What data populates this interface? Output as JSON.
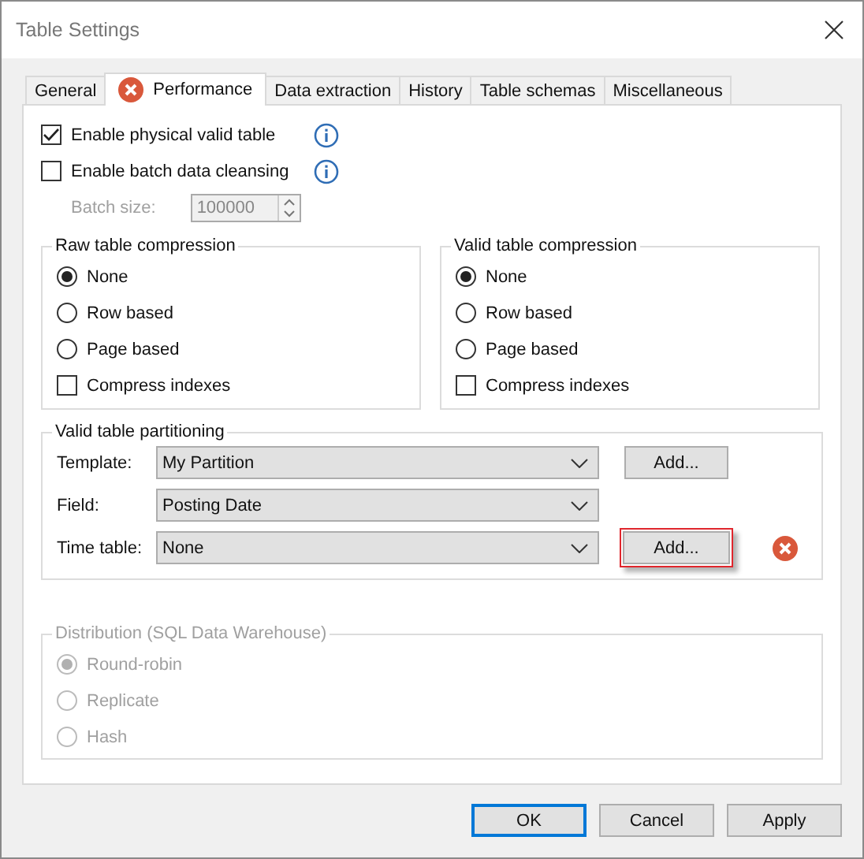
{
  "window": {
    "title": "Table Settings"
  },
  "tabs": [
    {
      "label": "General",
      "selected": false,
      "error": false
    },
    {
      "label": "Performance",
      "selected": true,
      "error": true
    },
    {
      "label": "Data extraction",
      "selected": false,
      "error": false
    },
    {
      "label": "History",
      "selected": false,
      "error": false
    },
    {
      "label": "Table schemas",
      "selected": false,
      "error": false
    },
    {
      "label": "Miscellaneous",
      "selected": false,
      "error": false
    }
  ],
  "options": [
    {
      "label": "Enable physical valid table",
      "checked": true,
      "info": true
    },
    {
      "label": "Enable batch data cleansing",
      "checked": false,
      "info": true
    }
  ],
  "batch_size": {
    "label": "Batch size:",
    "value": "100000",
    "disabled": true
  },
  "compression_groups": [
    {
      "title": "Raw table compression",
      "options": [
        {
          "kind": "radio",
          "label": "None",
          "selected": true
        },
        {
          "kind": "radio",
          "label": "Row based",
          "selected": false
        },
        {
          "kind": "radio",
          "label": "Page based",
          "selected": false
        },
        {
          "kind": "checkbox",
          "label": "Compress indexes",
          "checked": false
        }
      ]
    },
    {
      "title": "Valid table compression",
      "options": [
        {
          "kind": "radio",
          "label": "None",
          "selected": true
        },
        {
          "kind": "radio",
          "label": "Row based",
          "selected": false
        },
        {
          "kind": "radio",
          "label": "Page based",
          "selected": false
        },
        {
          "kind": "checkbox",
          "label": "Compress indexes",
          "checked": false
        }
      ]
    }
  ],
  "partitioning": {
    "title": "Valid table partitioning",
    "rows": [
      {
        "label": "Template:",
        "value": "My Partition",
        "button": "Add...",
        "highlighted": false,
        "error": false
      },
      {
        "label": "Field:",
        "value": "Posting Date",
        "error": false
      },
      {
        "label": "Time table:",
        "value": "None",
        "button": "Add...",
        "highlighted": true,
        "error": true
      }
    ]
  },
  "distribution": {
    "title": "Distribution (SQL Data Warehouse)",
    "disabled": true,
    "options": [
      {
        "label": "Round-robin",
        "selected": true
      },
      {
        "label": "Replicate",
        "selected": false
      },
      {
        "label": "Hash",
        "selected": false
      }
    ]
  },
  "buttons": [
    {
      "label": "OK",
      "default": true
    },
    {
      "label": "Cancel",
      "default": false
    },
    {
      "label": "Apply",
      "default": false
    }
  ]
}
